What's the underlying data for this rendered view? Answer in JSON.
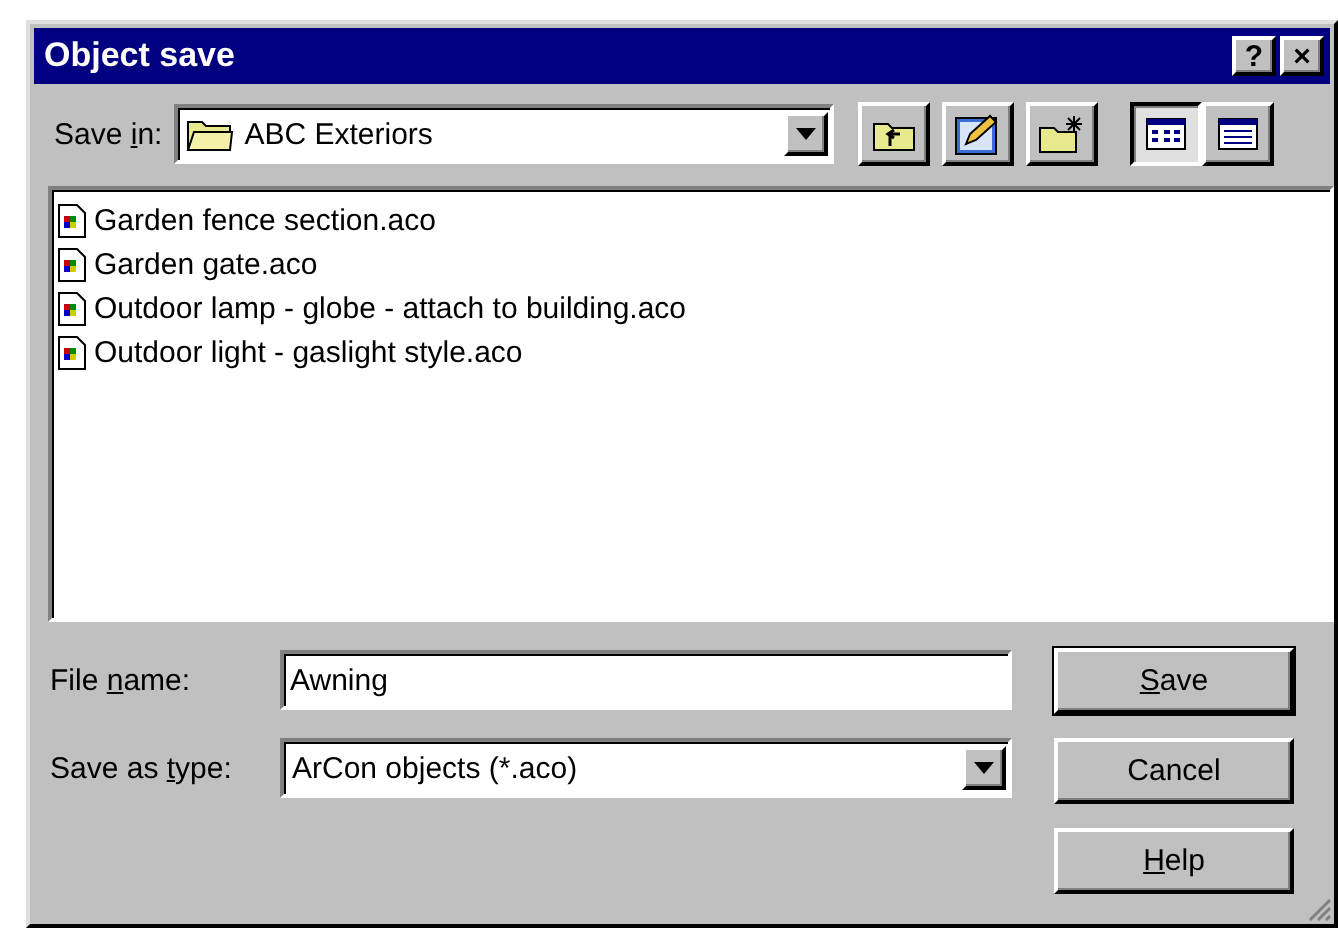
{
  "window": {
    "title": "Object save",
    "help_button": "?",
    "close_button": "×"
  },
  "save_in": {
    "label": {
      "before": "Save ",
      "key": "i",
      "after": "n:"
    },
    "value": "ABC Exteriors"
  },
  "toolbar": [
    {
      "kind": "up-folder"
    },
    {
      "kind": "edit"
    },
    {
      "kind": "new-folder"
    }
  ],
  "views": [
    {
      "kind": "list",
      "selected": true
    },
    {
      "kind": "details",
      "selected": false
    }
  ],
  "files": [
    {
      "name": "Garden fence section.aco"
    },
    {
      "name": "Garden gate.aco"
    },
    {
      "name": "Outdoor lamp - globe - attach to building.aco"
    },
    {
      "name": "Outdoor light - gaslight style.aco"
    }
  ],
  "file_name": {
    "label": {
      "before": "File ",
      "key": "n",
      "after": "ame:"
    },
    "value": "Awning"
  },
  "save_as_type": {
    "label": {
      "before": "Save as ",
      "key": "t",
      "after": "ype:"
    },
    "value": "ArCon objects (*.aco)"
  },
  "buttons": [
    {
      "key": "S",
      "after": "ave",
      "default": true
    },
    {
      "before": "Cancel",
      "default": false
    },
    {
      "key": "H",
      "after": "elp",
      "default": false
    }
  ]
}
